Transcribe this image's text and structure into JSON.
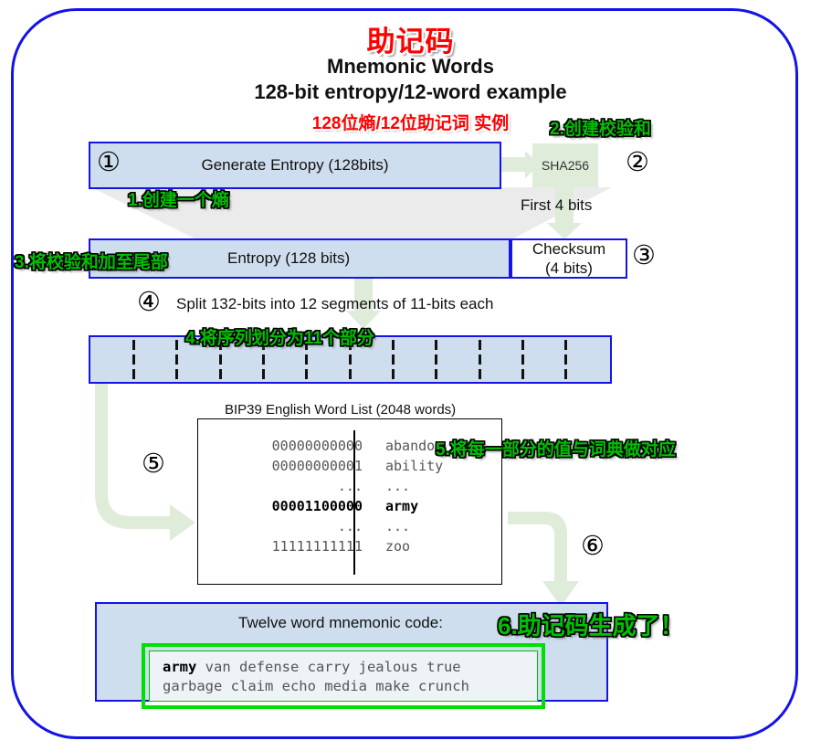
{
  "diagram": {
    "title_cn": "助记码",
    "title_en_line1": "Mnemonic Words",
    "title_en_line2": "128-bit entropy/12-word example",
    "subtitle_cn": "128位熵/12位助记词 实例",
    "frame_color": "#1414e6",
    "box_fill": "#cfdeef",
    "note_color": "#00c000",
    "title_color": "#ff0000",
    "arrow_color": "#dfecda"
  },
  "steps": {
    "one": "①",
    "two": "②",
    "three": "③",
    "four": "④",
    "five": "⑤",
    "six": "⑥"
  },
  "notes": {
    "n1": "1.创建一个熵",
    "n2": "2.创建校验和",
    "n3": "3.将校验和加至尾部",
    "n4": "4.将序列划分为11个部分",
    "n5": "5.将每一部分的值与词典做对应",
    "n6": "6.助记码生成了！"
  },
  "row1": {
    "entropy_label": "Generate Entropy (128bits)",
    "hash_label": "SHA256",
    "first_bits_label": "First 4 bits"
  },
  "row2": {
    "entropy_label": "Entropy (128 bits)",
    "checksum_line1": "Checksum",
    "checksum_line2": "(4 bits)"
  },
  "row3": {
    "split_label": "Split 132-bits into 12 segments of 11-bits each",
    "segment_count": 12,
    "divider_count": 11
  },
  "wordlist": {
    "caption": "BIP39 English Word List (2048 words)",
    "rows": [
      {
        "bits": "00000000000",
        "word": "abandon",
        "highlight": false
      },
      {
        "bits": "00000000001",
        "word": "ability",
        "highlight": false
      },
      {
        "bits": "...",
        "word": "...",
        "highlight": false
      },
      {
        "bits": "00001100000",
        "word": "army",
        "highlight": true
      },
      {
        "bits": "...",
        "word": "...",
        "highlight": false
      },
      {
        "bits": "11111111111",
        "word": "zoo",
        "highlight": false
      }
    ]
  },
  "result": {
    "caption": "Twelve word mnemonic code:",
    "first_word": "army",
    "rest_line1": " van defense carry jealous true",
    "line2": "garbage claim echo media make crunch"
  }
}
